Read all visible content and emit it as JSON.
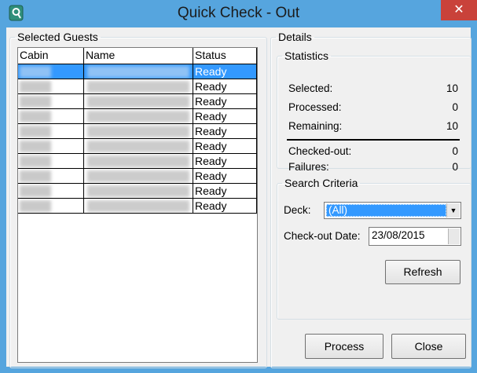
{
  "window": {
    "title": "Quick Check - Out",
    "close_glyph": "✕",
    "app_icon": "app-logo-icon"
  },
  "guests": {
    "legend": "Selected Guests",
    "columns": [
      "Cabin",
      "Name",
      "Status"
    ],
    "rows": [
      {
        "status": "Ready",
        "selected": true
      },
      {
        "status": "Ready"
      },
      {
        "status": "Ready"
      },
      {
        "status": "Ready"
      },
      {
        "status": "Ready"
      },
      {
        "status": "Ready"
      },
      {
        "status": "Ready"
      },
      {
        "status": "Ready"
      },
      {
        "status": "Ready"
      },
      {
        "status": "Ready"
      }
    ]
  },
  "details": {
    "legend": "Details",
    "statistics": {
      "legend": "Statistics",
      "selected_label": "Selected:",
      "selected_value": "10",
      "processed_label": "Processed:",
      "processed_value": "0",
      "remaining_label": "Remaining:",
      "remaining_value": "10",
      "checked_out_label": "Checked-out:",
      "checked_out_value": "0",
      "failures_label": "Failures:",
      "failures_value": "0"
    },
    "search": {
      "legend": "Search Criteria",
      "deck_label": "Deck:",
      "deck_value": "(All)",
      "date_label": "Check-out Date:",
      "date_value": "23/08/2015",
      "refresh_label": "Refresh"
    }
  },
  "actions": {
    "process_label": "Process",
    "close_label": "Close"
  },
  "colors": {
    "title_bar": "#56a5de",
    "selection": "#3399ff",
    "close_button": "#c9423a"
  }
}
